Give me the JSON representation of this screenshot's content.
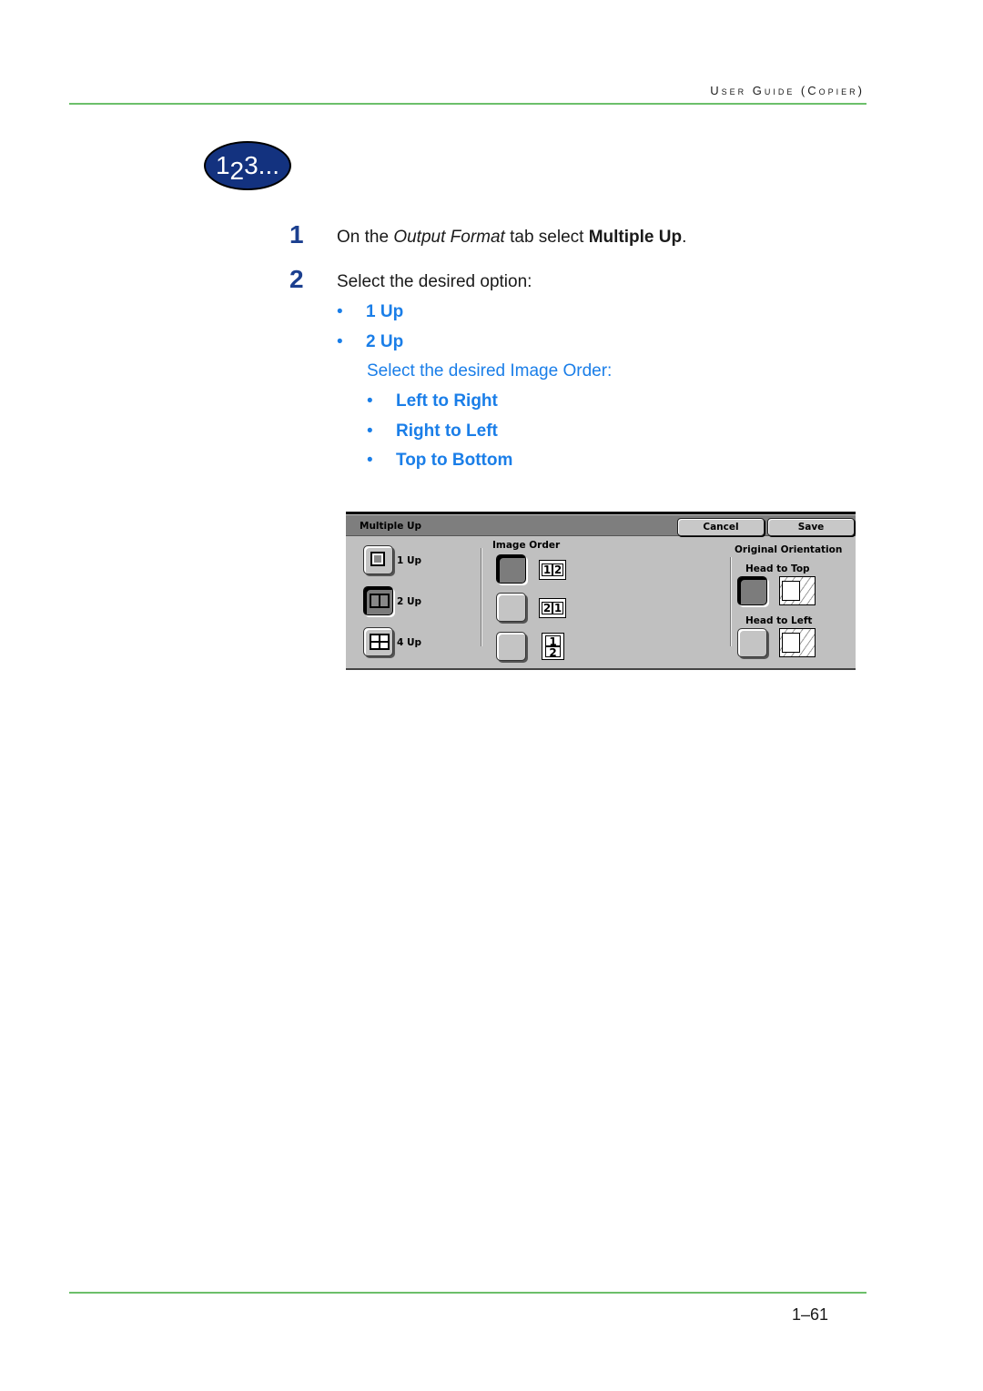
{
  "header": {
    "running_head": "User Guide (Copier)"
  },
  "steps_icon": {
    "main": "1",
    "sub": "2",
    "rest": "3..."
  },
  "steps": [
    {
      "number": "1",
      "text_prefix": "On the ",
      "text_italic": "Output Format",
      "text_middle": " tab select ",
      "text_bold": "Multiple Up",
      "text_suffix": "."
    },
    {
      "number": "2",
      "text": "Select the desired option:"
    }
  ],
  "options": [
    {
      "bullet": "•",
      "label": "1 Up"
    },
    {
      "bullet": "•",
      "label": "2 Up"
    }
  ],
  "image_order": {
    "heading": "Select the desired Image Order:",
    "items": [
      {
        "bullet": "•",
        "label": "Left to Right"
      },
      {
        "bullet": "•",
        "label": "Right to Left"
      },
      {
        "bullet": "•",
        "label": "Top to Bottom"
      }
    ]
  },
  "panel": {
    "title": "Multiple Up",
    "cancel_label": "Cancel",
    "save_label": "Save",
    "up_options": [
      {
        "label": "1 Up",
        "selected": false
      },
      {
        "label": "2 Up",
        "selected": true
      },
      {
        "label": "4 Up",
        "selected": false
      }
    ],
    "image_order_heading": "Image Order",
    "image_order_options": [
      {
        "cells": [
          "1",
          "2"
        ],
        "selected": true
      },
      {
        "cells": [
          "2",
          "1"
        ],
        "selected": false
      },
      {
        "cells": [
          "1",
          "2"
        ],
        "selected": false
      }
    ],
    "orientation_heading": "Original Orientation",
    "orientation_options": [
      {
        "label": "Head to Top",
        "selected": true
      },
      {
        "label": "Head to Left",
        "selected": false
      }
    ]
  },
  "footer": {
    "page_number": "1–61"
  },
  "colors": {
    "accent_blue": "#1a7ee8",
    "step_blue": "#1b3f8f",
    "rule_green": "#6cbf6a",
    "icon_navy": "#13327f"
  }
}
